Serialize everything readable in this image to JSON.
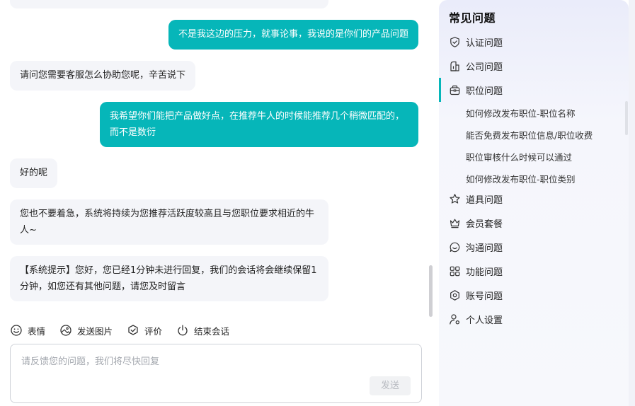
{
  "chat": {
    "messages": [
      {
        "side": "out",
        "lines": [
          "不是我这边的压力，就事论事，我说的是你们的产品问题"
        ]
      },
      {
        "side": "in",
        "lines": [
          "请问您需要客服怎么协助您呢，辛苦说下"
        ]
      },
      {
        "side": "out",
        "lines": [
          "我希望你们能把产品做好点，在推荐牛人的时候能推荐几个稍微匹配的，",
          "而不是数衍"
        ]
      },
      {
        "side": "in",
        "lines": [
          "好的呢"
        ]
      },
      {
        "side": "in",
        "lines": [
          "您也不要着急，系统将持续为您推荐活跃度较高且与您职位要求相近的牛",
          "人~"
        ]
      },
      {
        "side": "in",
        "lines": [
          "【系统提示】您好，您已经1分钟未进行回复，我们的会话将会继续保留1",
          "分钟，如您还有其他问题，请您及时留言"
        ]
      }
    ],
    "toolbar": {
      "emoji_label": "表情",
      "image_label": "发送图片",
      "rate_label": "评价",
      "end_label": "结束会话"
    },
    "input": {
      "placeholder": "请反馈您的问题，我们将尽快回复",
      "value": "",
      "send_label": "发送"
    }
  },
  "faq": {
    "title_main": "常见",
    "title_accent": "问题",
    "categories": [
      {
        "label": "认证问题",
        "icon": "shield-check-icon"
      },
      {
        "label": "公司问题",
        "icon": "building-icon"
      },
      {
        "label": "职位问题",
        "icon": "briefcase-icon",
        "active": true,
        "items": [
          "如何修改发布职位-职位名称",
          "能否免费发布职位信息/职位收费",
          "职位审核什么时候可以通过",
          "如何修改发布职位-职位类别"
        ]
      },
      {
        "label": "道具问题",
        "icon": "star-icon"
      },
      {
        "label": "会员套餐",
        "icon": "crown-icon"
      },
      {
        "label": "沟通问题",
        "icon": "chat-icon"
      },
      {
        "label": "功能问题",
        "icon": "grid-icon"
      },
      {
        "label": "账号问题",
        "icon": "hexagon-icon"
      },
      {
        "label": "个人设置",
        "icon": "user-settings-icon"
      }
    ]
  },
  "colors": {
    "accent": "#06b6b9",
    "bubble_in": "#f4f5f9",
    "text": "#222222"
  }
}
